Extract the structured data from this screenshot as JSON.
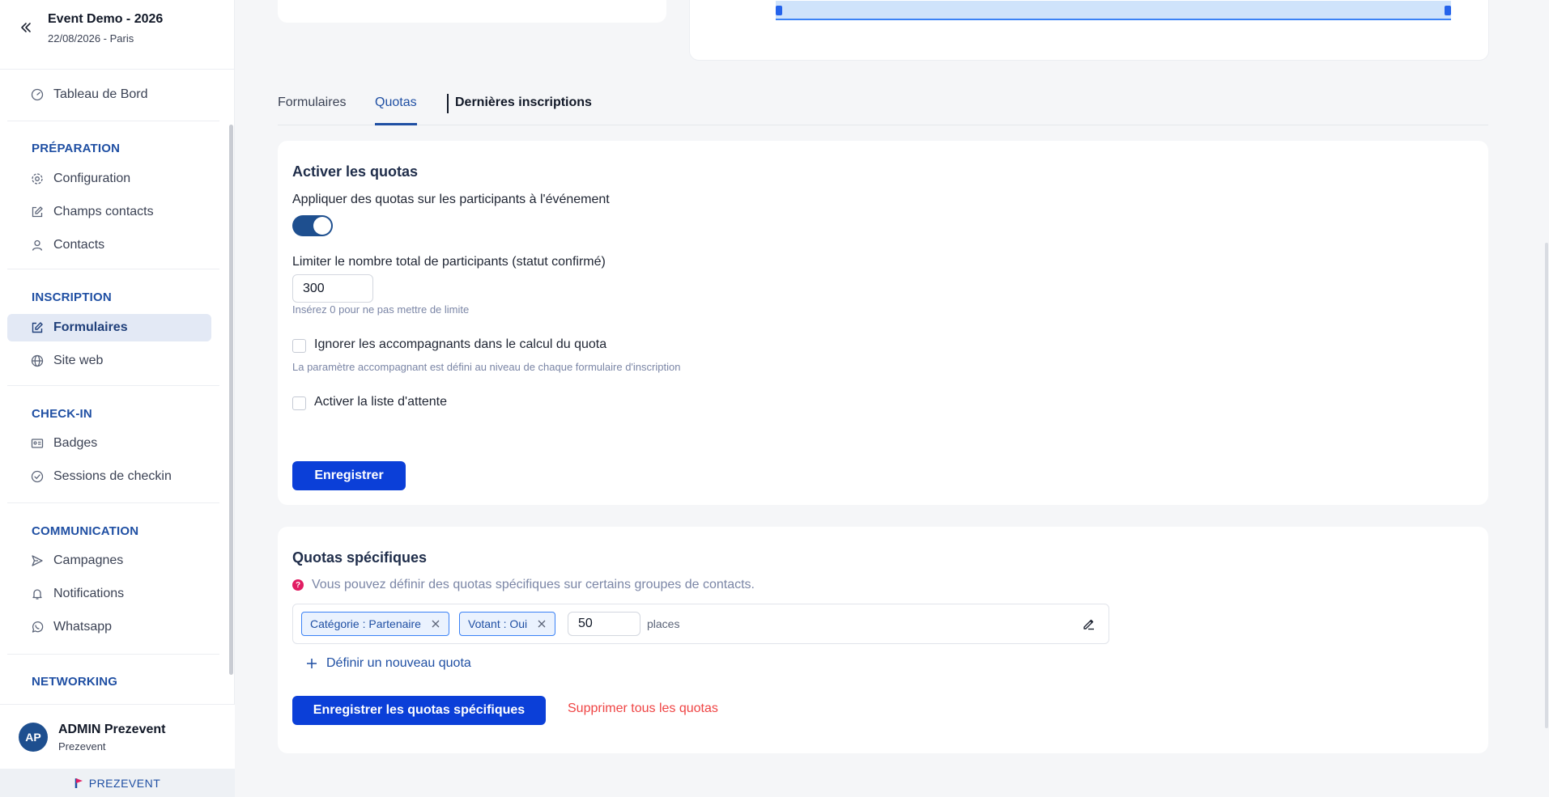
{
  "event": {
    "title": "Event Demo - 2026",
    "subtitle": "22/08/2026 - Paris"
  },
  "sidebar": {
    "dashboard": "Tableau de Bord",
    "sections": [
      {
        "title": "PRÉPARATION",
        "items": [
          "Configuration",
          "Champs contacts",
          "Contacts"
        ]
      },
      {
        "title": "INSCRIPTION",
        "items": [
          "Formulaires",
          "Site web"
        ]
      },
      {
        "title": "CHECK-IN",
        "items": [
          "Badges",
          "Sessions de checkin"
        ]
      },
      {
        "title": "COMMUNICATION",
        "items": [
          "Campagnes",
          "Notifications",
          "Whatsapp"
        ]
      },
      {
        "title": "NETWORKING",
        "items": []
      }
    ],
    "active_item": "Formulaires"
  },
  "user": {
    "initials": "AP",
    "name": "ADMIN Prezevent",
    "org": "Prezevent"
  },
  "brand": "PREZEVENT",
  "tabs": [
    {
      "label": "Formulaires",
      "active": false
    },
    {
      "label": "Quotas",
      "active": true
    },
    {
      "label": "Dernières inscriptions",
      "active": false
    }
  ],
  "quotas": {
    "title": "Activer les quotas",
    "apply_label": "Appliquer des quotas sur les participants à l'événement",
    "apply_enabled": true,
    "limit_label": "Limiter le nombre total de participants (statut confirmé)",
    "limit_value": "300",
    "limit_hint": "Insérez 0 pour ne pas mettre de limite",
    "ignore_label": "Ignorer les accompagnants dans le calcul du quota",
    "ignore_checked": false,
    "ignore_hint": "La paramètre accompagnant est défini au niveau de chaque formulaire d'inscription",
    "waitlist_label": "Activer la liste d'attente",
    "waitlist_checked": false,
    "save_label": "Enregistrer"
  },
  "specific": {
    "title": "Quotas spécifiques",
    "info": "Vous pouvez définir des quotas spécifiques sur certains groupes de contacts.",
    "info_icon": "?",
    "rows": [
      {
        "tags": [
          "Catégorie : Partenaire",
          "Votant : Oui"
        ],
        "value": "50",
        "unit": "places"
      }
    ],
    "add_label": "Définir un nouveau quota",
    "save_label": "Enregistrer les quotas spécifiques",
    "delete_label": "Supprimer tous les quotas"
  },
  "colors": {
    "accent": "#1f4fa3",
    "primary_button": "#0b3fd8",
    "danger": "#ef4444",
    "toggle_on": "#1e4f8f"
  }
}
